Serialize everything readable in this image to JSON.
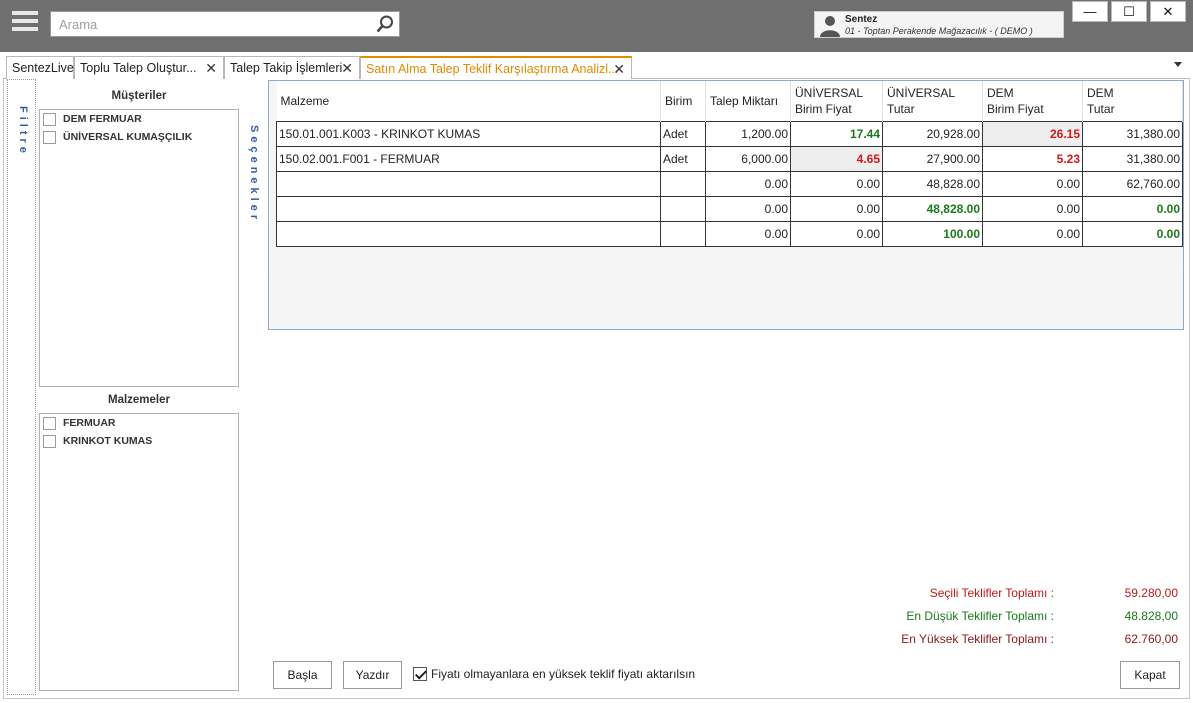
{
  "search": {
    "placeholder": "Arama"
  },
  "user": {
    "name": "Sentez",
    "company": "01 - Toptan Perakende Mağazacılık - ( DEMO )"
  },
  "window_buttons": {
    "minimize": "—",
    "maximize": "☐",
    "close": "✕"
  },
  "tabs": [
    {
      "label": "SentezLive",
      "closable": false
    },
    {
      "label": "Toplu Talep Oluştur...",
      "closable": true
    },
    {
      "label": "Talep Takip İşlemleri",
      "closable": true
    },
    {
      "label": "Satın Alma Talep Teklif Karşılaştırma Analizl...",
      "closable": true,
      "active": true
    }
  ],
  "tab_close": "✕",
  "filter_label": "Filtre",
  "options_label": "Seçenekler",
  "customers": {
    "title": "Müşteriler",
    "items": [
      "DEM FERMUAR",
      "ÜNİVERSAL KUMAŞÇILIK"
    ]
  },
  "materials": {
    "title": "Malzemeler",
    "items": [
      "FERMUAR",
      "KRINKOT KUMAS"
    ]
  },
  "grid": {
    "columns": [
      "Malzeme",
      "Birim",
      "Talep Miktarı",
      "ÜNİVERSAL\nBirim Fiyat",
      "ÜNİVERSAL\nTutar",
      "DEM\nBirim Fiyat",
      "DEM\nTutar"
    ],
    "rows": [
      [
        "150.01.001.K003 - KRINKOT KUMAS",
        "Adet",
        "1,200.00",
        "17.44",
        "20,928.00",
        "26.15",
        "31,380.00"
      ],
      [
        "150.02.001.F001 - FERMUAR",
        "Adet",
        "6,000.00",
        "4.65",
        "27,900.00",
        "5.23",
        "31,380.00"
      ],
      [
        "",
        "",
        "0.00",
        "0.00",
        "48,828.00",
        "0.00",
        "62,760.00"
      ],
      [
        "",
        "",
        "0.00",
        "0.00",
        "48,828.00",
        "0.00",
        "0.00"
      ],
      [
        "",
        "",
        "0.00",
        "0.00",
        "100.00",
        "0.00",
        "0.00"
      ]
    ]
  },
  "totals": [
    {
      "label": "Seçili Teklifler Toplamı :",
      "value": "59.280,00",
      "color": "#c0191c"
    },
    {
      "label": "En Düşük Teklifler Toplamı :",
      "value": "48.828,00",
      "color": "#1a7a1a"
    },
    {
      "label": "En Yüksek Teklifler Toplamı :",
      "value": "62.760,00",
      "color": "#8b1a1a"
    }
  ],
  "buttons": {
    "start": "Başla",
    "print": "Yazdır",
    "close": "Kapat"
  },
  "option_checkbox": {
    "label": "Fiyatı olmayanlara en yüksek teklif fiyatı aktarılsın",
    "checked": true
  },
  "colors": {
    "accent": "#e08a00",
    "topbar": "#6f6f6f",
    "low_price": "#1a7a1a",
    "high_price": "#d01818"
  }
}
